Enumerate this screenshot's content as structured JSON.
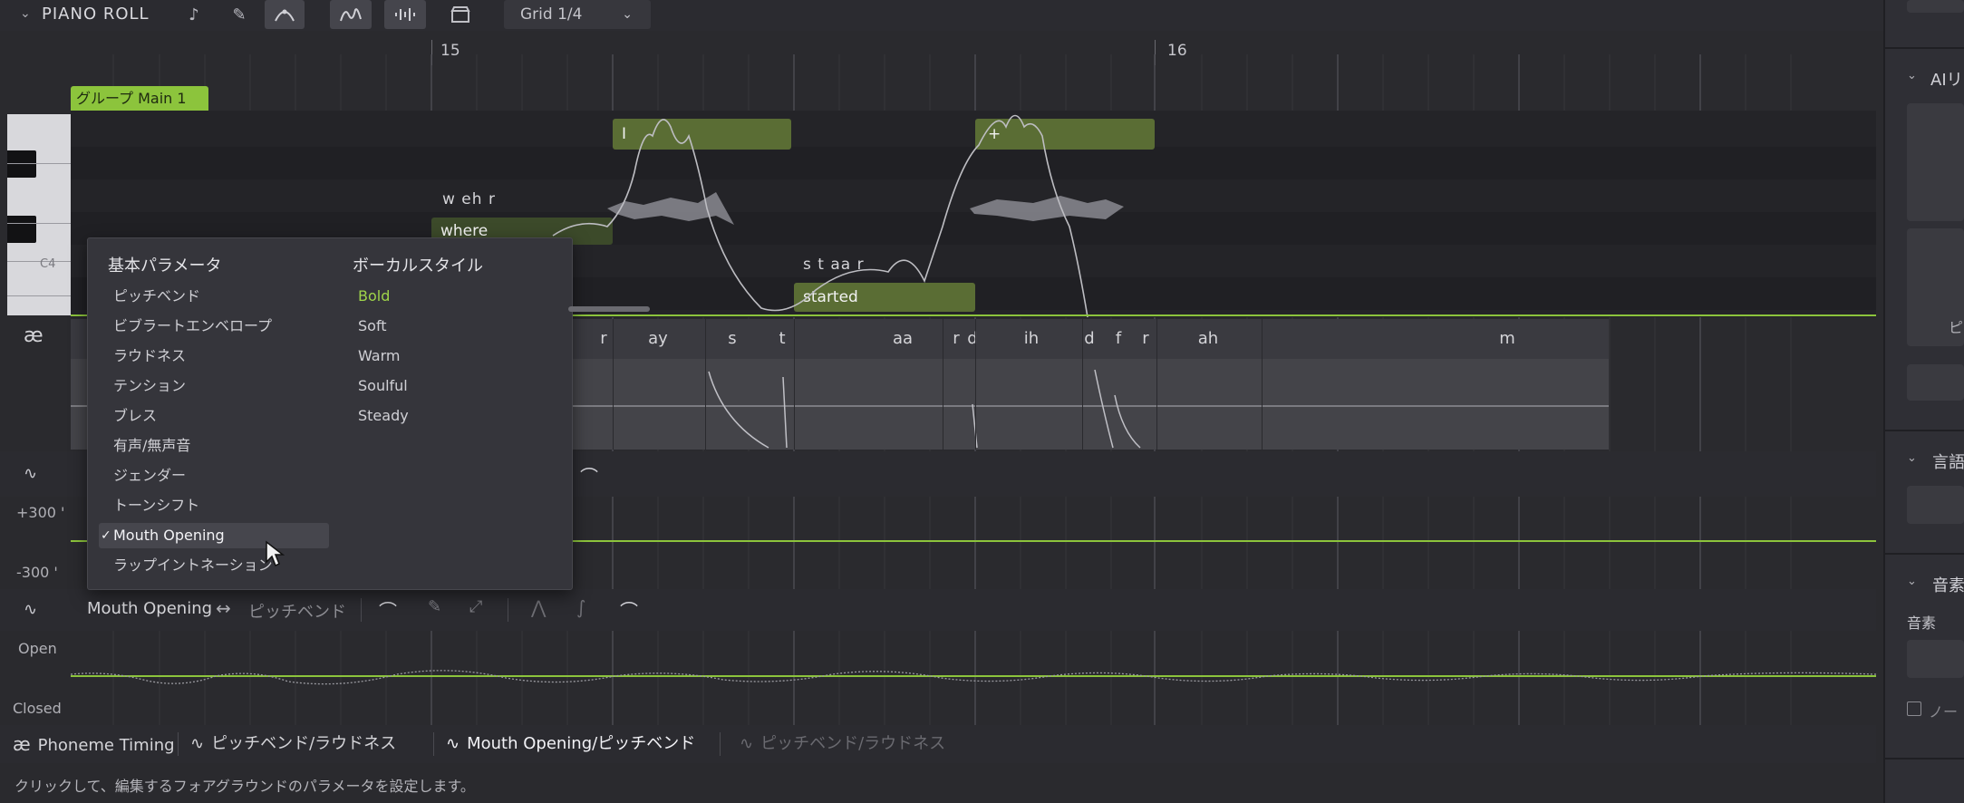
{
  "toolbar": {
    "section_title": "PIANO ROLL",
    "grid_value": "Grid 1/4"
  },
  "ruler": {
    "measure_15": "15",
    "measure_16": "16"
  },
  "group": {
    "label": "グループ Main 1"
  },
  "notes": [
    {
      "lyric": "I"
    },
    {
      "lyric": "+"
    },
    {
      "lyric": "where",
      "phonemes": "w eh r"
    },
    {
      "lyric": "started",
      "phonemes": "s t aa r"
    }
  ],
  "keys": {
    "c4_label": "C4"
  },
  "phoneme_row": {
    "icon_text": "æ",
    "phonemes": [
      "r",
      "ay",
      "s",
      "t",
      "aa",
      "r",
      "d",
      "ih",
      "d",
      "f",
      "r",
      "ah",
      "m"
    ]
  },
  "param_lane": {
    "plus_label": "+300 '",
    "minus_label": "-300 '"
  },
  "popup": {
    "basic_header": "基本パラメータ",
    "style_header": "ボーカルスタイル",
    "basic_items": [
      "ピッチベンド",
      "ビブラートエンベロープ",
      "ラウドネス",
      "テンション",
      "ブレス",
      "有声/無声音",
      "ジェンダー",
      "トーンシフト",
      "Mouth Opening",
      "ラップイントネーション"
    ],
    "selected_item": "Mouth Opening",
    "check_mark": "✓",
    "style_items": [
      "Bold",
      "Soft",
      "Warm",
      "Soulful",
      "Steady"
    ],
    "active_style": "Bold"
  },
  "sub_toolbar": {
    "fg_param": "Mouth Opening",
    "swap_symbol": "↔",
    "bg_param": "ピッチベンド"
  },
  "mouth_lane": {
    "open_label": "Open",
    "closed_label": "Closed"
  },
  "tabs": [
    {
      "label": "Phoneme Timing",
      "icon": "æ"
    },
    {
      "label": "ピッチベンド/ラウドネス"
    },
    {
      "label": "Mouth Opening/ピッチベンド"
    },
    {
      "label": "ピッチベンド/ラウドネス"
    }
  ],
  "status_text": "クリックして、編集するフォアグラウンドのパラメータを設定します。",
  "right_panel": {
    "ai_label": "AIリ",
    "lang_label": "言語",
    "phoneme_label_1": "音素",
    "phoneme_label_2": "音素",
    "note_label": "ノー",
    "char_pi": "ピ"
  },
  "colors": {
    "accent_green": "#8cc43c",
    "note_green": "#5a6d34",
    "panel_bg": "#2a2a2e"
  }
}
